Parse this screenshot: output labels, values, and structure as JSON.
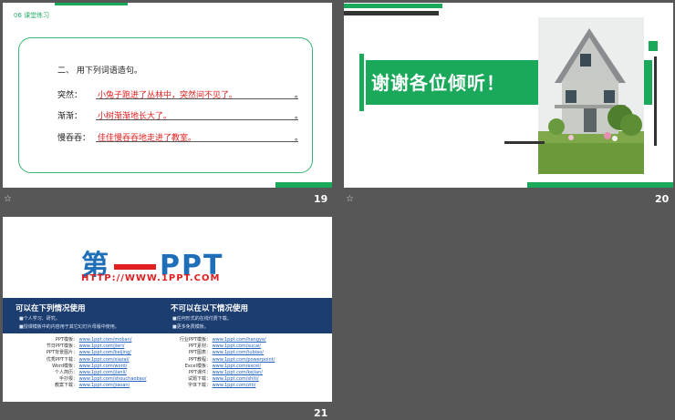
{
  "slides": [
    {
      "number": "19",
      "section_tag": "06   课堂练习",
      "question": "二、  用下列词语造句。",
      "rows": [
        {
          "label": "突然：",
          "answer": "小兔子跑进了丛林中，突然间不见了。",
          "end": "。"
        },
        {
          "label": "渐渐：",
          "answer": "小树渐渐地长大了。",
          "end": "。"
        },
        {
          "label": "慢吞吞：",
          "answer": "佳佳慢吞吞地走进了教室。",
          "end": "。"
        }
      ]
    },
    {
      "number": "20",
      "thanks": "谢谢各位倾听！"
    },
    {
      "number": "21",
      "logo_left": "第",
      "logo_right": "PPT",
      "url": "HTTP://WWW.1PPT.COM",
      "can_title": "可以在下列情况使用",
      "can_items": [
        "■个人学习、研究。",
        "■授课模板中的内容用于其它幻灯片母版中使用。"
      ],
      "cannot_title": "不可以在以下情况使用",
      "cannot_items": [
        "■任何形式的在线付费下载。",
        "■更多免费模板。"
      ],
      "left_links": [
        {
          "k": "PPT模板：",
          "v": "www.1ppt.com/moban/"
        },
        {
          "k": "节日PPT模板：",
          "v": "www.1ppt.com/jieri/"
        },
        {
          "k": "PPT背景图片：",
          "v": "www.1ppt.com/beijing/"
        },
        {
          "k": "优秀PPT下载：",
          "v": "www.1ppt.com/xiazai/"
        },
        {
          "k": "Word模板：",
          "v": "www.1ppt.com/word/"
        },
        {
          "k": "个人简历：",
          "v": "www.1ppt.com/jianli/"
        },
        {
          "k": "手抄报：",
          "v": "www.1ppt.com/shouchaobao/"
        },
        {
          "k": "教案下载：",
          "v": "www.1ppt.com/jiaoan/"
        }
      ],
      "right_links": [
        {
          "k": "行业PPT模板：",
          "v": "www.1ppt.com/hangye/"
        },
        {
          "k": "PPT素材：",
          "v": "www.1ppt.com/sucai/"
        },
        {
          "k": "PPT图表：",
          "v": "www.1ppt.com/tubiao/"
        },
        {
          "k": "PPT教程：",
          "v": "www.1ppt.com/powerpoint/"
        },
        {
          "k": "Excel模板：",
          "v": "www.1ppt.com/excel/"
        },
        {
          "k": "PPT课件：",
          "v": "www.1ppt.com/kejian/"
        },
        {
          "k": "试题下载：",
          "v": "www.1ppt.com/shiti/"
        },
        {
          "k": "字体下载：",
          "v": "www.1ppt.com/ziti/"
        }
      ]
    }
  ]
}
